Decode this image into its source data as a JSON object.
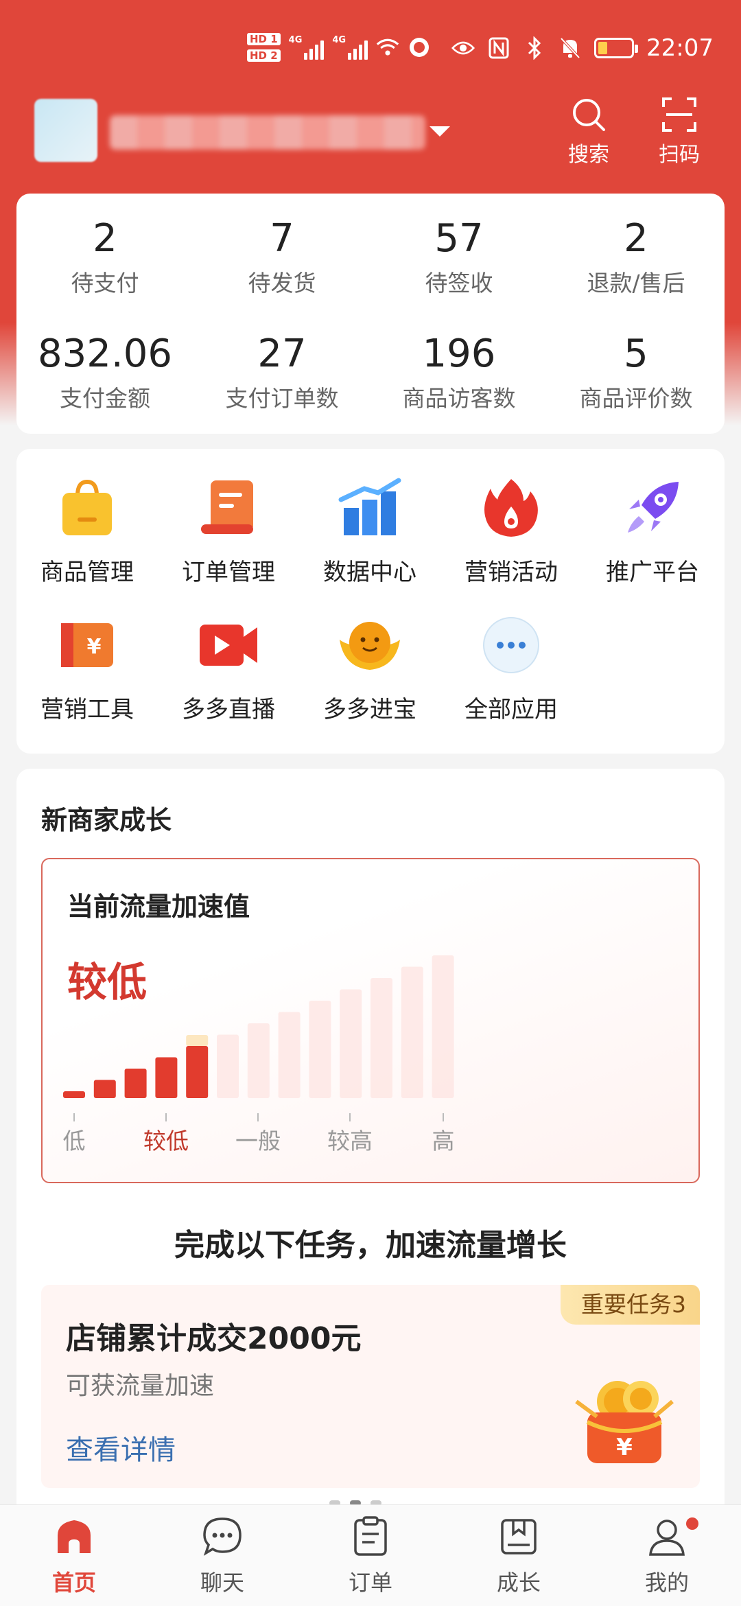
{
  "status_bar": {
    "sim1": "HD 1",
    "sim2": "HD 2",
    "network1": "4G",
    "network2": "4G",
    "time": "22:07",
    "icons": [
      "wifi-icon",
      "hotspot-icon",
      "eye-icon",
      "nfc-icon",
      "bluetooth-icon",
      "mute-icon",
      "battery-icon"
    ]
  },
  "header": {
    "search_label": "搜索",
    "scan_label": "扫码"
  },
  "stats": [
    {
      "value": "2",
      "label": "待支付"
    },
    {
      "value": "7",
      "label": "待发货"
    },
    {
      "value": "57",
      "label": "待签收"
    },
    {
      "value": "2",
      "label": "退款/售后"
    },
    {
      "value": "832.06",
      "label": "支付金额"
    },
    {
      "value": "27",
      "label": "支付订单数"
    },
    {
      "value": "196",
      "label": "商品访客数"
    },
    {
      "value": "5",
      "label": "商品评价数"
    }
  ],
  "apps": [
    {
      "label": "商品管理",
      "icon": "shopping-bag-icon"
    },
    {
      "label": "订单管理",
      "icon": "order-scroll-icon"
    },
    {
      "label": "数据中心",
      "icon": "bar-chart-icon"
    },
    {
      "label": "营销活动",
      "icon": "fire-icon"
    },
    {
      "label": "推广平台",
      "icon": "rocket-icon"
    },
    {
      "label": "营销工具",
      "icon": "coupon-icon"
    },
    {
      "label": "多多直播",
      "icon": "live-video-icon"
    },
    {
      "label": "多多进宝",
      "icon": "ingot-icon"
    },
    {
      "label": "全部应用",
      "icon": "more-icon"
    }
  ],
  "growth": {
    "title": "新商家成长",
    "speed_title": "当前流量加速值",
    "speed_level": "较低",
    "scale_labels": [
      "低",
      "较低",
      "一般",
      "较高",
      "高"
    ],
    "active_scale": 1,
    "bar_count": 13,
    "filled_bars": 5,
    "task_heading": "完成以下任务，加速流量增长",
    "task": {
      "badge": "重要任务3",
      "title": "店铺累计成交2000元",
      "subtitle": "可获流量加速",
      "link": "查看详情"
    }
  },
  "tabs": [
    {
      "label": "首页",
      "icon": "home-icon",
      "active": true
    },
    {
      "label": "聊天",
      "icon": "chat-icon",
      "active": false
    },
    {
      "label": "订单",
      "icon": "order-icon",
      "active": false
    },
    {
      "label": "成长",
      "icon": "growth-book-icon",
      "active": false
    },
    {
      "label": "我的",
      "icon": "profile-icon",
      "active": false
    }
  ],
  "colors": {
    "brand": "#e0463a",
    "accent_text": "#d3392f",
    "link": "#3a6fb0"
  }
}
